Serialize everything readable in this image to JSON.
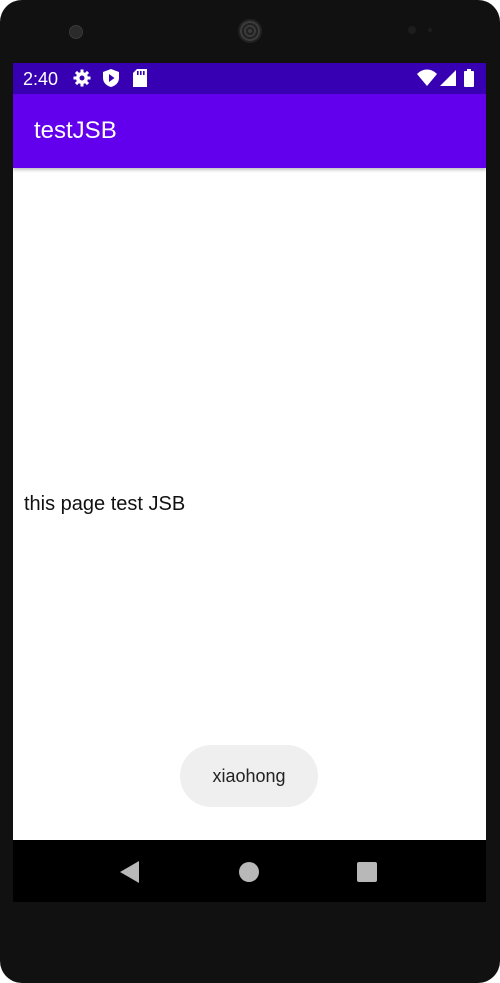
{
  "status_bar": {
    "time": "2:40",
    "left_icons": [
      "settings-icon",
      "shield-play-icon",
      "sd-card-icon"
    ],
    "right_icons": [
      "wifi-icon",
      "cell-signal-icon",
      "battery-icon"
    ],
    "background": "#3700b3"
  },
  "app_bar": {
    "title": "testJSB",
    "background": "#6200ee"
  },
  "content": {
    "text": "this page test JSB"
  },
  "toast": {
    "text": "xiaohong"
  },
  "nav_bar": {
    "buttons": [
      "back-icon",
      "home-icon",
      "recents-icon"
    ]
  }
}
